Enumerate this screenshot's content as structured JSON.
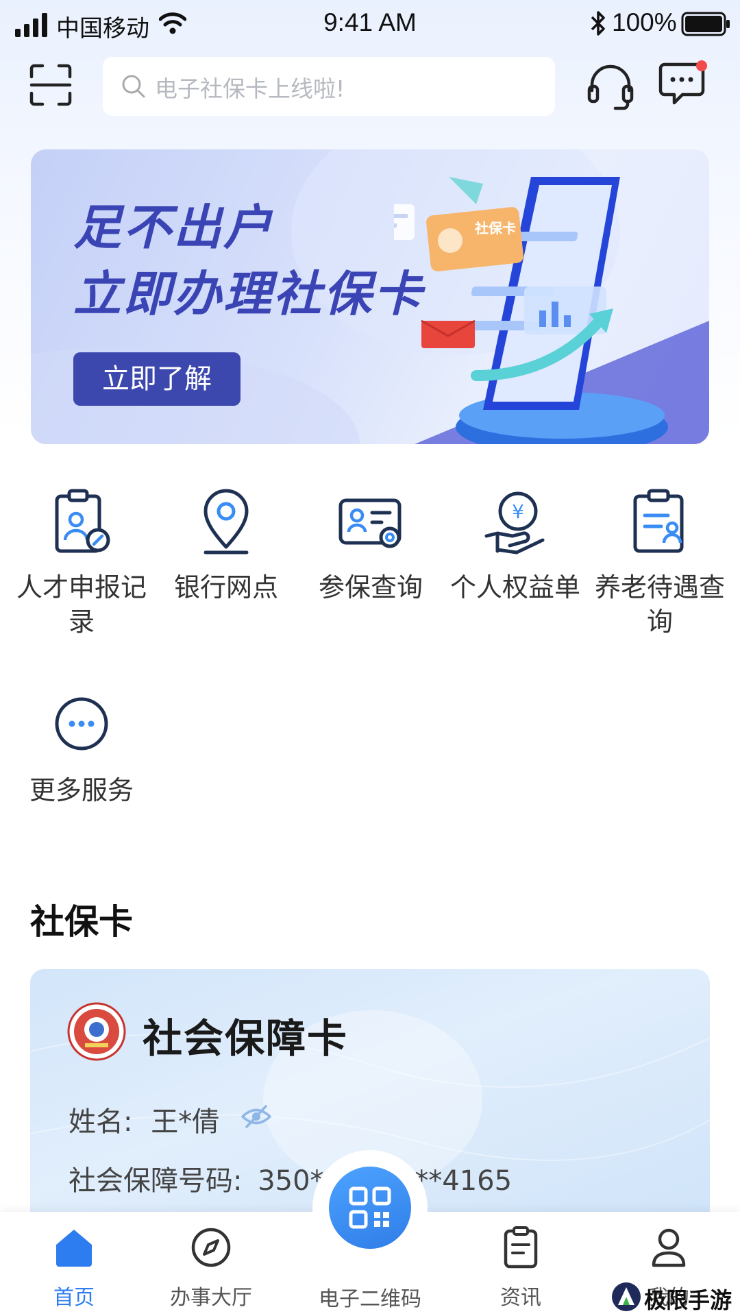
{
  "status_bar": {
    "carrier": "中国移动",
    "time": "9:41 AM",
    "battery": "100%"
  },
  "header": {
    "search_placeholder": "电子社保卡上线啦!"
  },
  "banner": {
    "line1": "足不出户",
    "line2": "立即办理社保卡",
    "button": "立即了解",
    "card_text": "社保卡"
  },
  "services": [
    {
      "label": "人才申报记录",
      "icon": "clipboard-person-icon"
    },
    {
      "label": "银行网点",
      "icon": "location-pin-icon"
    },
    {
      "label": "参保查询",
      "icon": "id-card-search-icon"
    },
    {
      "label": "个人权益单",
      "icon": "hand-yuan-coin-icon"
    },
    {
      "label": "养老待遇查询",
      "icon": "clipboard-elder-icon"
    },
    {
      "label": "更多服务",
      "icon": "more-dots-icon"
    }
  ],
  "section": {
    "title": "社保卡"
  },
  "card": {
    "title": "社会保障卡",
    "name_label": "姓名:",
    "name_value": "王*倩",
    "number_label": "社会保障号码:",
    "number_value": "350**",
    "number_tail": "**4165"
  },
  "tabbar": [
    {
      "label": "首页",
      "icon": "home-icon",
      "active": true
    },
    {
      "label": "办事大厅",
      "icon": "compass-icon",
      "active": false
    },
    {
      "label": "电子二维码",
      "icon": "qr-code-icon",
      "active": false
    },
    {
      "label": "资讯",
      "icon": "news-icon",
      "active": false
    },
    {
      "label": "我的",
      "icon": "user-icon",
      "active": false
    }
  ],
  "watermark": {
    "text": "极限手游网"
  },
  "colors": {
    "accent": "#2d7cf0",
    "banner_text": "#3a44b4",
    "banner_button": "#3c48ad"
  }
}
